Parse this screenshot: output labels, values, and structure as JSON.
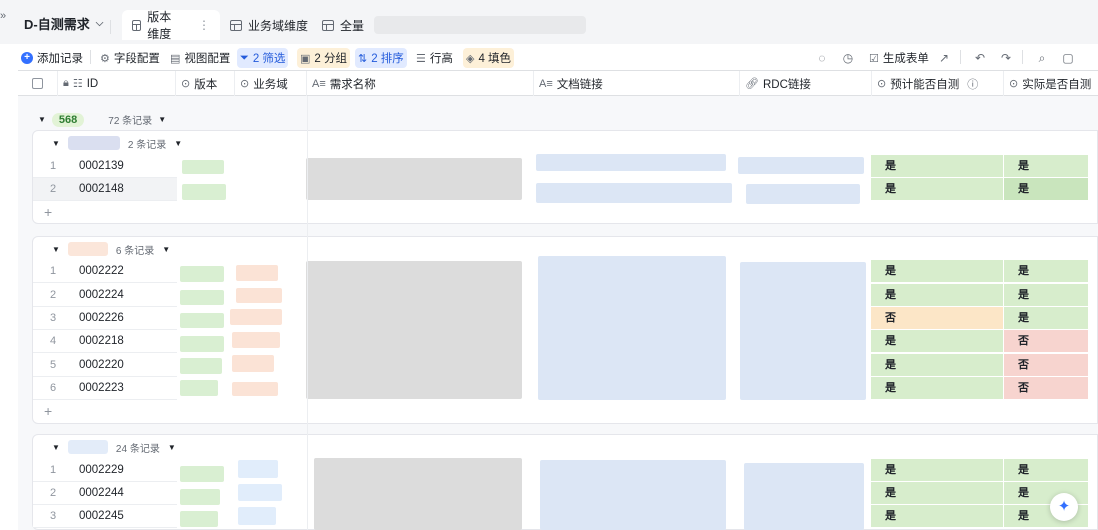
{
  "app": {
    "title": "D-自测需求"
  },
  "tabs": [
    {
      "label": "版本维度",
      "active": true
    },
    {
      "label": "业务域维度",
      "active": false
    },
    {
      "label": "全量",
      "active": false
    }
  ],
  "toolbar": {
    "add_record": "添加记录",
    "field_config": "字段配置",
    "view_config": "视图配置",
    "filter": "2 筛选",
    "group": "2 分组",
    "sort": "2 排序",
    "row_height": "行高",
    "fill": "4 填色",
    "generate_form": "生成表单"
  },
  "columns": {
    "id": "ID",
    "version": "版本",
    "domain": "业务域",
    "req_name": "需求名称",
    "doc_link": "文档链接",
    "rdc_link": "RDC链接",
    "expected_self_test": "预计能否自测",
    "actual_self_test": "实际是否自测"
  },
  "groups": [
    {
      "label": "568",
      "count": "72 条记录",
      "subgroups": [
        {
          "count": "2 条记录",
          "rows": [
            {
              "n": "1",
              "id": "0002139",
              "expected": "是",
              "actual": "是"
            },
            {
              "n": "2",
              "id": "0002148",
              "expected": "是",
              "actual": "是"
            }
          ]
        },
        {
          "count": "6 条记录",
          "rows": [
            {
              "n": "1",
              "id": "0002222",
              "expected": "是",
              "actual": "是"
            },
            {
              "n": "2",
              "id": "0002224",
              "expected": "是",
              "actual": "是"
            },
            {
              "n": "3",
              "id": "0002226",
              "expected": "否",
              "actual": "是"
            },
            {
              "n": "4",
              "id": "0002218",
              "expected": "是",
              "actual": "否"
            },
            {
              "n": "5",
              "id": "0002220",
              "expected": "是",
              "actual": "否"
            },
            {
              "n": "6",
              "id": "0002223",
              "expected": "是",
              "actual": "否"
            }
          ]
        },
        {
          "count": "24 条记录",
          "rows": [
            {
              "n": "1",
              "id": "0002229",
              "expected": "是",
              "actual": "是"
            },
            {
              "n": "2",
              "id": "0002244",
              "expected": "是",
              "actual": "是"
            },
            {
              "n": "3",
              "id": "0002245",
              "expected": "是",
              "actual": "是"
            }
          ]
        }
      ]
    }
  ],
  "colors": {
    "accent": "#3370ff",
    "yes_green": "#d7edcc",
    "no_orange": "#fce6c7",
    "no_red": "#f7d4cf"
  }
}
